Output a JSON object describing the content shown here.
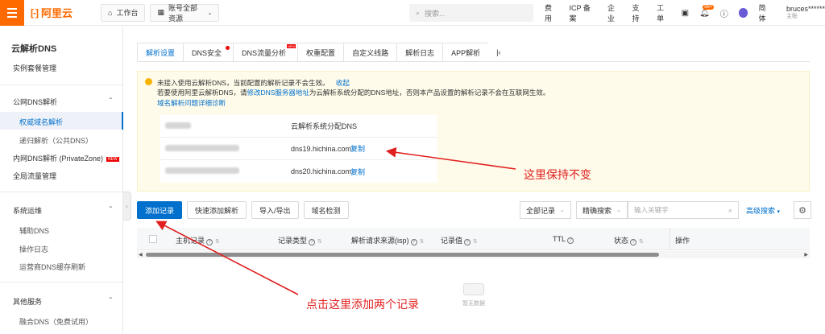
{
  "topbar": {
    "logo": "阿里云",
    "workbench": "工作台",
    "account_resources": "账号全部资源",
    "search_placeholder": "搜索...",
    "nav": [
      "费用",
      "ICP 备案",
      "企业",
      "支持",
      "工单"
    ],
    "notif_badge": "99+",
    "lang": "简体",
    "user": "bruces******",
    "user_sub": "主账"
  },
  "sidebar": {
    "title": "云解析DNS",
    "instance_mgmt": "实例套餐管理",
    "section1": "公网DNS解析",
    "authoritative": "权威域名解析",
    "recursive": "递归解析（公共DNS）",
    "private_zone": "内网DNS解析 (PrivateZone)",
    "new_tag": "NEW",
    "global_traffic": "全局流量管理",
    "section2": "系统运维",
    "aux_dns": "辅助DNS",
    "op_log": "操作日志",
    "isp_cache": "运营商DNS缓存刷新",
    "section3": "其他服务",
    "fusion_dns": "融合DNS（免费试用）"
  },
  "tabs": [
    "解析设置",
    "DNS安全",
    "DNS流量分析",
    "权重配置",
    "自定义线路",
    "解析日志",
    "APP解析"
  ],
  "tab_new": "NEW",
  "notice": {
    "line1": "未接入使用云解析DNS，当前配置的解析记录不会生效。",
    "collapse": "收起",
    "line2_a": "若要使用阿里云解析DNS，请",
    "line2_link": "修改DNS服务器地址",
    "line2_b": "为云解析系统分配的DNS地址，否则本产品设置的解析记录不会在互联网生效。",
    "help": "域名解析问题详细诊断",
    "table_header": "云解析系统分配DNS",
    "dns": [
      {
        "server": "dns19.hichina.com",
        "copy": "复制"
      },
      {
        "server": "dns20.hichina.com",
        "copy": "复制"
      }
    ]
  },
  "annotations": {
    "keep": "这里保持不变",
    "add_hint": "点击这里添加两个记录"
  },
  "toolbar": {
    "add_record": "添加记录",
    "quick_add": "快速添加解析",
    "import_export": "导入/导出",
    "domain_check": "域名检测",
    "all_records": "全部记录",
    "exact_search": "精确搜索",
    "keyword_placeholder": "输入关键字",
    "advanced_search": "高级搜索"
  },
  "table": {
    "columns": [
      "主机记录",
      "记录类型",
      "解析请求来源(isp)",
      "记录值",
      "TTL",
      "状态",
      "操作"
    ],
    "empty": "暂无数据"
  },
  "colors": {
    "accent": "#0070cc",
    "brand": "#ff6a00",
    "annotation": "#e02020"
  }
}
